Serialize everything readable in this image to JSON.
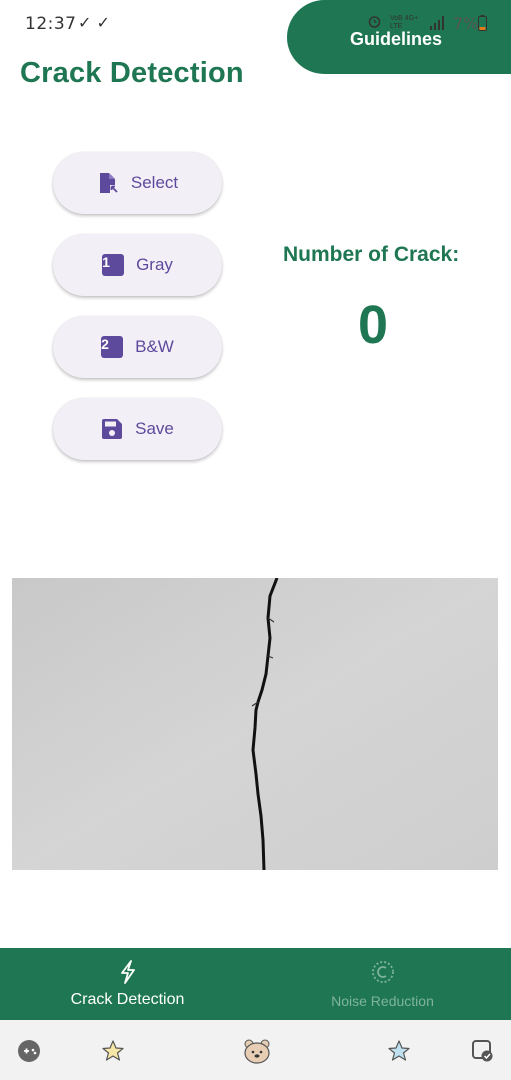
{
  "status_bar": {
    "time": "12:37",
    "checks": "✓ ✓",
    "network": "VoB 4G+\nLTE",
    "battery_pct": "7%"
  },
  "header": {
    "title": "Crack Detection",
    "guidelines_label": "Guidelines"
  },
  "actions": {
    "select_label": "Select",
    "gray_label": "Gray",
    "gray_step": "1",
    "bw_label": "B&W",
    "bw_step": "2",
    "save_label": "Save"
  },
  "result": {
    "label": "Number of Crack:",
    "count": "0"
  },
  "bottom_nav": {
    "items": [
      {
        "label": "Crack Detection",
        "icon": "lightning-icon",
        "active": true
      },
      {
        "label": "Noise Reduction",
        "icon": "noise-icon",
        "active": false
      }
    ]
  },
  "colors": {
    "brand_green": "#1e7752",
    "button_bg": "#f3eff7",
    "button_fg": "#5d4a9c",
    "inactive_nav": "#7fb39b"
  }
}
